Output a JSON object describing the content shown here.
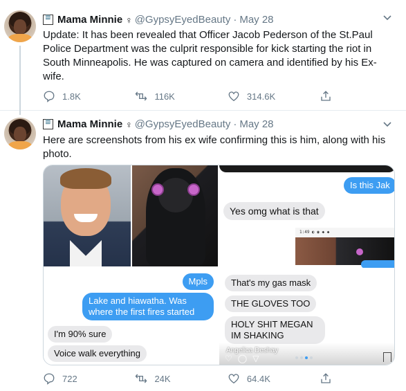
{
  "tweets": [
    {
      "avatar": "avatar",
      "header": {
        "emoji": "🆒",
        "display_name": "Mama Minnie",
        "gender_symbol": "♀",
        "handle": "@GypsyEyedBeauty",
        "separator": "·",
        "date": "May 28"
      },
      "text": "Update: It has been revealed that Officer Jacob Pederson of the St.Paul Police Department was the culprit responsible for kick starting the riot in South Minneapolis. He was captured on camera and identified by his Ex-wife.",
      "actions": {
        "reply": "1.8K",
        "retweet": "116K",
        "like": "314.6K"
      }
    },
    {
      "avatar": "avatar",
      "header": {
        "emoji": "🆒",
        "display_name": "Mama Minnie",
        "gender_symbol": "♀",
        "handle": "@GypsyEyedBeauty",
        "separator": "·",
        "date": "May 28"
      },
      "text": "Here are screenshots from his ex wife confirming this is him, along with his photo.",
      "media": {
        "left_chat": {
          "mpls": "Mpls",
          "lake": "Lake and hiawatha. Was where the first fires started",
          "ninety": "I'm 90% sure",
          "voice": "Voice walk everything"
        },
        "right_chat": {
          "is_this": "Is this Jak",
          "yes": "Yes omg what is that",
          "screenshot_status": "1:49  ◐ ◉ ◆ ◆",
          "gas_mask": "That's my gas mask",
          "gloves": "THE GLOVES TOO",
          "holy": "HOLY SHIT MEGAN IM SHAKING",
          "author": "Angelica Deshay"
        }
      },
      "actions": {
        "reply": "722",
        "retweet": "24K",
        "like": "64.4K"
      }
    }
  ],
  "colors": {
    "blue_bubble": "#3d9df2",
    "gray_bubble": "#e9e9eb",
    "secondary_text": "#657786"
  },
  "icons": [
    "reply-icon",
    "retweet-icon",
    "like-icon",
    "share-icon",
    "caret-down-icon"
  ]
}
